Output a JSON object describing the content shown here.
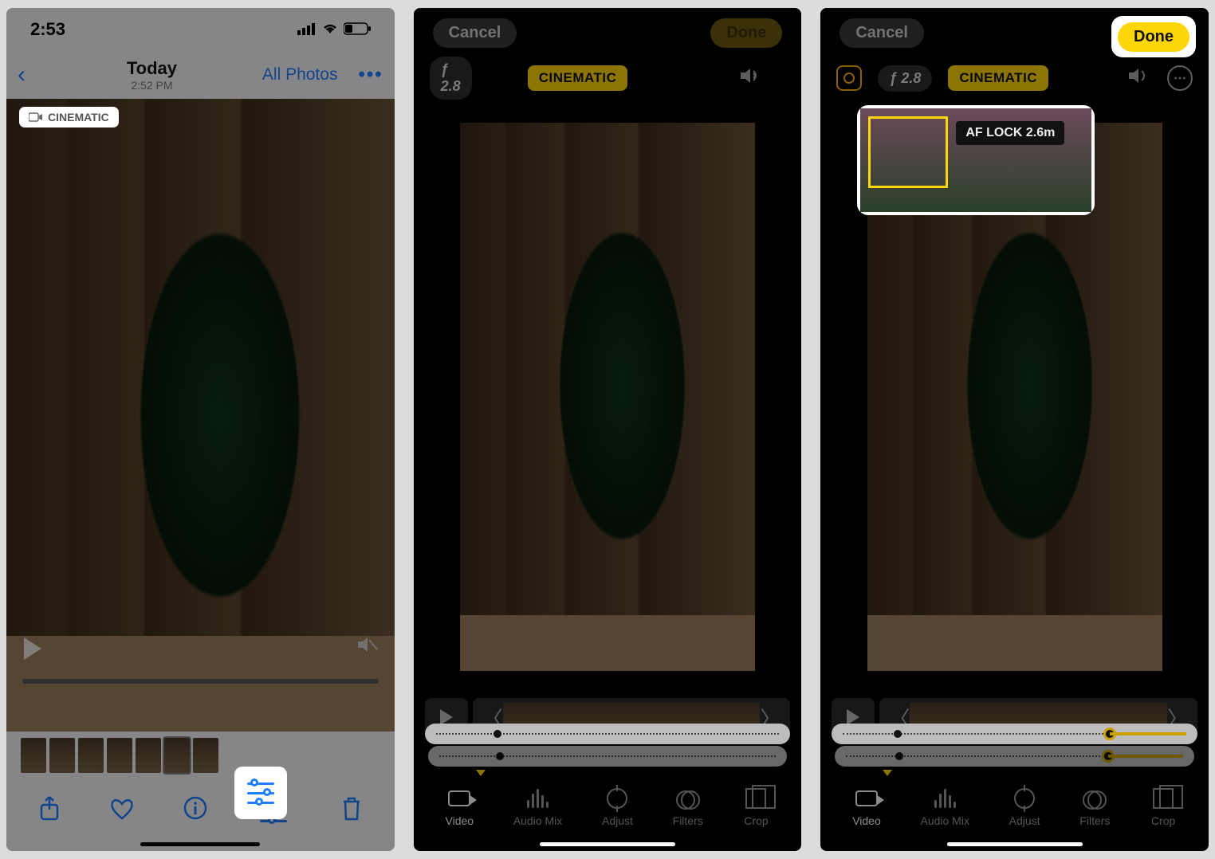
{
  "phone1": {
    "status": {
      "time": "2:53",
      "battery": "30"
    },
    "nav": {
      "title": "Today",
      "subtitle": "2:52 PM",
      "all_photos": "All Photos",
      "more_glyph": "•••"
    },
    "viewer": {
      "cinematic_label": "CINEMATIC"
    },
    "bottombar": {
      "share": "share-icon",
      "favorite": "heart-icon",
      "info": "info-icon",
      "edit": "sliders-icon",
      "delete": "trash-icon"
    }
  },
  "phone2": {
    "topbar": {
      "cancel": "Cancel",
      "done": "Done"
    },
    "toolbar": {
      "fstop": "ƒ 2.8",
      "cinematic": "CINEMATIC"
    },
    "tabs": {
      "video": "Video",
      "audio_mix": "Audio Mix",
      "adjust": "Adjust",
      "filters": "Filters",
      "crop": "Crop"
    }
  },
  "phone3": {
    "topbar": {
      "cancel": "Cancel",
      "done": "Done"
    },
    "toolbar": {
      "fstop": "ƒ 2.8",
      "cinematic": "CINEMATIC"
    },
    "af_lock_label": "AF LOCK 2.6m",
    "tabs": {
      "video": "Video",
      "audio_mix": "Audio Mix",
      "adjust": "Adjust",
      "filters": "Filters",
      "crop": "Crop"
    }
  }
}
